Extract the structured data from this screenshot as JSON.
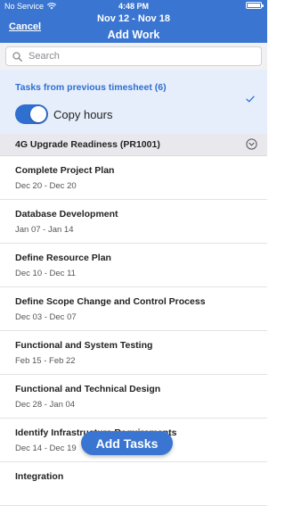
{
  "status_bar": {
    "carrier": "No Service",
    "time": "4:48 PM",
    "battery_level": 1.0,
    "icons": [
      "wifi-icon",
      "battery-icon"
    ]
  },
  "header": {
    "cancel_label": "Cancel",
    "date_range": "Nov 12 - Nov 18",
    "title": "Add Work"
  },
  "search": {
    "placeholder": "Search",
    "value": ""
  },
  "previous": {
    "label": "Tasks from previous timesheet (6)",
    "copy_label": "Copy hours",
    "copy_enabled": true,
    "selected": true
  },
  "project": {
    "name": "4G Upgrade Readiness (PR1001)",
    "expanded": true
  },
  "tasks": [
    {
      "name": "Complete Project Plan",
      "dates": "Dec 20 - Dec 20"
    },
    {
      "name": "Database Development",
      "dates": "Jan 07 - Jan 14"
    },
    {
      "name": "Define Resource Plan",
      "dates": "Dec 10 - Dec 11"
    },
    {
      "name": "Define Scope Change and Control Process",
      "dates": "Dec 03 - Dec 07"
    },
    {
      "name": "Functional and System Testing",
      "dates": "Feb 15 - Feb 22"
    },
    {
      "name": "Functional and Technical Design",
      "dates": "Dec 28 - Jan 04"
    },
    {
      "name": "Identify Infrastructure Requirements",
      "dates": "Dec 14 - Dec 19"
    },
    {
      "name": "Integration",
      "dates": ""
    }
  ],
  "add_button_label": "Add Tasks",
  "colors": {
    "header": "#3a76d1",
    "accent": "#2f6fd0",
    "highlight": "#e6eefb"
  }
}
